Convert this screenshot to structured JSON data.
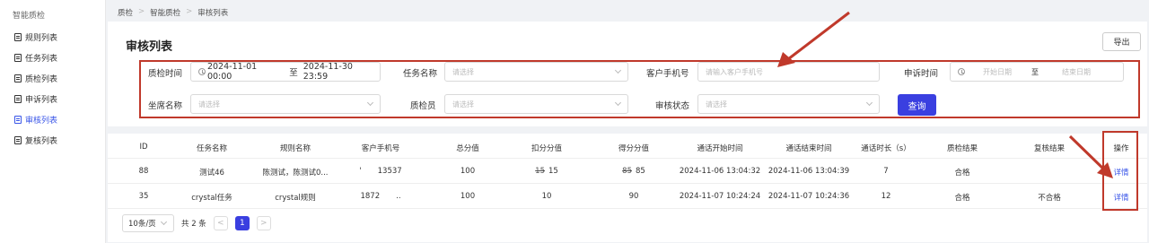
{
  "sidebar": {
    "title": "智能质检",
    "items": [
      {
        "label": "规则列表",
        "active": false
      },
      {
        "label": "任务列表",
        "active": false
      },
      {
        "label": "质检列表",
        "active": false
      },
      {
        "label": "申诉列表",
        "active": false
      },
      {
        "label": "审核列表",
        "active": true
      },
      {
        "label": "复核列表",
        "active": false
      }
    ]
  },
  "breadcrumb": [
    "质检",
    "智能质检",
    "审核列表"
  ],
  "page": {
    "title": "审核列表",
    "export_label": "导出"
  },
  "filters": {
    "qc_time_label": "质检时间",
    "qc_time_start": "2024-11-01 00:00",
    "qc_time_sep": "至",
    "qc_time_end": "2024-11-30 23:59",
    "task_name_label": "任务名称",
    "task_name_placeholder": "请选择",
    "phone_label": "客户手机号",
    "phone_placeholder": "请输入客户手机号",
    "appeal_time_label": "申诉时间",
    "appeal_start_placeholder": "开始日期",
    "appeal_sep": "至",
    "appeal_end_placeholder": "结束日期",
    "agent_label": "坐席名称",
    "agent_placeholder": "请选择",
    "inspector_label": "质检员",
    "inspector_placeholder": "请选择",
    "status_label": "审核状态",
    "status_placeholder": "请选择",
    "query_label": "查询"
  },
  "table": {
    "headers": [
      "ID",
      "任务名称",
      "规则名称",
      "客户手机号",
      "总分值",
      "扣分分值",
      "得分分值",
      "通话开始时间",
      "通话结束时间",
      "通话时长（s）",
      "质检结果",
      "复核结果",
      "操作"
    ],
    "rows": [
      {
        "id": "88",
        "task": "测试46",
        "rule": "陈测试，陈测试0...",
        "phone_prefix": "'",
        "phone_suffix": "13537",
        "total": "100",
        "deduct_old": "15",
        "deduct": "15",
        "score_old": "85",
        "score": "85",
        "start": "2024-11-06 13:04:32",
        "end": "2024-11-06 13:04:39",
        "duration": "7",
        "result": "合格",
        "review": "",
        "action": "详情"
      },
      {
        "id": "35",
        "task": "crystal任务",
        "rule": "crystal规则",
        "phone_prefix": "1872",
        "phone_suffix": "..",
        "total": "100",
        "deduct_old": "",
        "deduct": "10",
        "score_old": "",
        "score": "90",
        "start": "2024-11-07 10:24:24",
        "end": "2024-11-07 10:24:36",
        "duration": "12",
        "result": "合格",
        "review": "不合格",
        "action": "详情"
      }
    ]
  },
  "pagination": {
    "page_size": "10条/页",
    "total": "共 2 条",
    "current": "1",
    "prev": "<",
    "next": ">"
  },
  "colors": {
    "accent": "#3a3fe0",
    "link": "#3a56e8",
    "annotation": "#c0392b"
  }
}
